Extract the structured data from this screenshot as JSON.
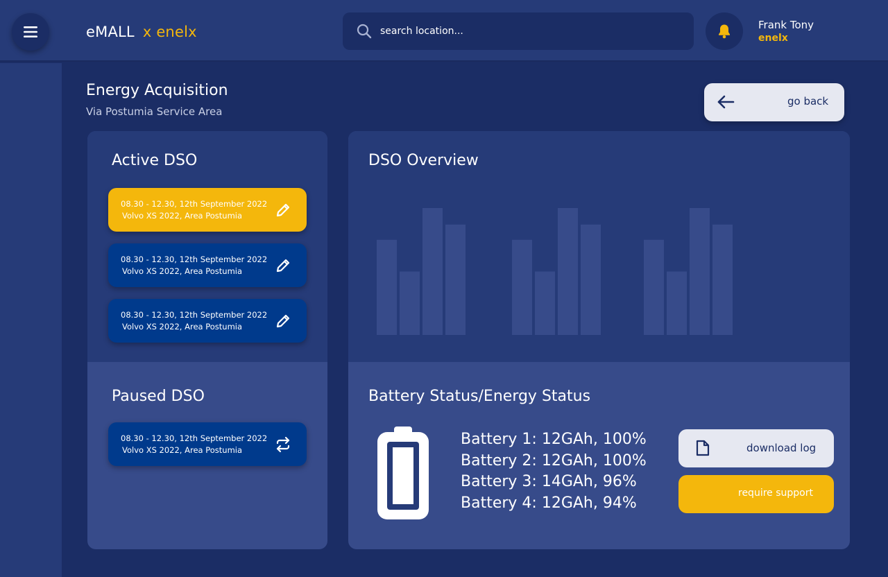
{
  "header": {
    "menu_icon": "hamburger-menu-icon",
    "brand_name": "eMALL",
    "brand_partner": "x enelx",
    "search": {
      "placeholder": "search location...",
      "icon": "search-icon"
    },
    "notification_icon": "bell-icon",
    "user": {
      "name": "Frank Tony",
      "org": "enelx"
    }
  },
  "page": {
    "title": "Energy Acquisition",
    "subtitle": "Via Postumia Service Area",
    "go_back_label": "go back"
  },
  "active_dso": {
    "title": "Active DSO",
    "items": [
      {
        "time": "08.30 - 12.30, 12th September 2022",
        "detail": "Volvo XS 2022, Area Postumia",
        "icon": "edit-pencil-icon",
        "highlighted": true
      },
      {
        "time": "08.30 - 12.30, 12th September 2022",
        "detail": "Volvo XS 2022, Area Postumia",
        "icon": "edit-pencil-icon",
        "highlighted": false
      },
      {
        "time": "08.30 - 12.30, 12th September 2022",
        "detail": "Volvo XS 2022, Area Postumia",
        "icon": "edit-pencil-icon",
        "highlighted": false
      }
    ]
  },
  "paused_dso": {
    "title": "Paused DSO",
    "items": [
      {
        "time": "08.30 - 12.30, 12th September 2022",
        "detail": "Volvo XS 2022, Area Postumia",
        "icon": "refresh-swap-icon"
      }
    ]
  },
  "overview": {
    "title": "DSO Overview"
  },
  "chart_data": {
    "type": "bar",
    "title": "",
    "groups": 3,
    "values": [
      [
        0.75,
        0.5,
        1.0,
        0.87
      ],
      [
        0.75,
        0.5,
        1.0,
        0.87
      ],
      [
        0.75,
        0.5,
        1.0,
        0.87
      ]
    ],
    "ylim": [
      0,
      1
    ],
    "grid": false,
    "bar_color": "#374b8a"
  },
  "battery": {
    "title": "Battery Status/Energy Status",
    "icon": "battery-full-icon",
    "lines": [
      "Battery 1: 12GAh, 100%",
      "Battery 2: 12GAh, 100%",
      "Battery 3: 14GAh, 96%",
      "Battery 4: 12GAh, 94%"
    ],
    "download_label": "download log",
    "download_icon": "document-icon",
    "support_label": "require support"
  },
  "colors": {
    "background": "#1b2d65",
    "panel": "#263b78",
    "panel_light": "#374b8a",
    "accent": "#f4b70c",
    "card_blue": "#003a8c",
    "button_light": "#e6e8f1"
  }
}
